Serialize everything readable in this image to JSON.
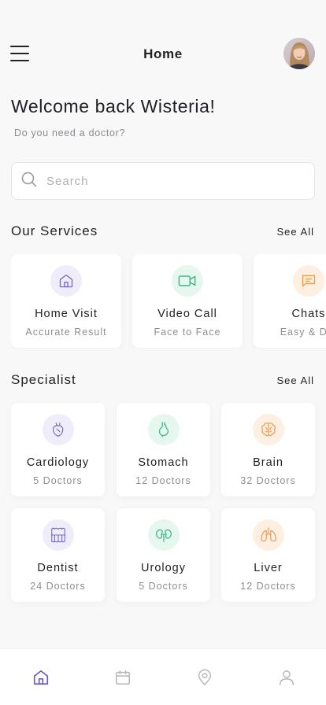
{
  "header": {
    "title": "Home",
    "menu_icon": "hamburger-menu-icon",
    "avatar": "user-avatar"
  },
  "welcome": {
    "title": "Welcome back Wisteria!",
    "subtitle": "Do you need a doctor?"
  },
  "search": {
    "placeholder": "Search",
    "value": "",
    "icon": "search-icon"
  },
  "services": {
    "title": "Our Services",
    "see_all": "See All",
    "items": [
      {
        "title": "Home Visit",
        "subtitle": "Accurate Result",
        "icon": "home-icon",
        "color": "#7b68c9",
        "bg": "#efedfa"
      },
      {
        "title": "Video Call",
        "subtitle": "Face to Face",
        "icon": "video-icon",
        "color": "#3db98a",
        "bg": "#e6f7ef"
      },
      {
        "title": "Chats",
        "subtitle": "Easy & Diff",
        "icon": "chat-icon",
        "color": "#ef9a4a",
        "bg": "#fdefe2"
      }
    ]
  },
  "specialist": {
    "title": "Specialist",
    "see_all": "See All",
    "items": [
      {
        "title": "Cardiology",
        "subtitle": "5 Doctors",
        "icon": "heart-icon",
        "color": "#7b68c9",
        "bg": "#efedfa"
      },
      {
        "title": "Stomach",
        "subtitle": "12 Doctors",
        "icon": "stomach-icon",
        "color": "#3db98a",
        "bg": "#e6f7ef"
      },
      {
        "title": "Brain",
        "subtitle": "32 Doctors",
        "icon": "brain-icon",
        "color": "#ef9a4a",
        "bg": "#fdefe2"
      },
      {
        "title": "Dentist",
        "subtitle": "24 Doctors",
        "icon": "tooth-icon",
        "color": "#7b68c9",
        "bg": "#efedfa"
      },
      {
        "title": "Urology",
        "subtitle": "5 Doctors",
        "icon": "kidney-icon",
        "color": "#3db98a",
        "bg": "#e6f7ef"
      },
      {
        "title": "Liver",
        "subtitle": "12 Doctors",
        "icon": "lungs-icon",
        "color": "#ef9a4a",
        "bg": "#fdefe2"
      }
    ]
  },
  "tabbar": {
    "active_color": "#6b5bc2",
    "inactive_color": "#b5b5ba",
    "items": [
      {
        "icon": "home-tab-icon",
        "active": true
      },
      {
        "icon": "calendar-tab-icon",
        "active": false
      },
      {
        "icon": "location-tab-icon",
        "active": false
      },
      {
        "icon": "profile-tab-icon",
        "active": false
      }
    ]
  }
}
